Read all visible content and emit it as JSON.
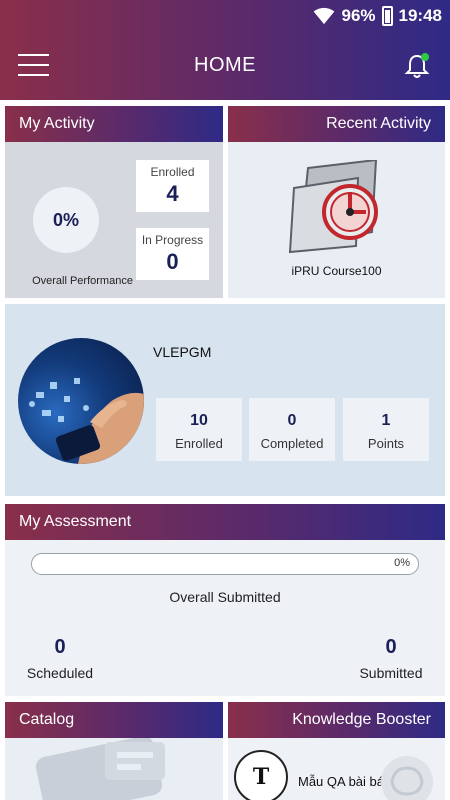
{
  "status_bar": {
    "battery": "96%",
    "time": "19:48"
  },
  "app_bar": {
    "title": "HOME"
  },
  "my_activity": {
    "header": "My Activity",
    "performance": "0%",
    "performance_label": "Overall Performance",
    "enrolled_label": "Enrolled",
    "enrolled_value": "4",
    "in_progress_label": "In Progress",
    "in_progress_value": "0"
  },
  "recent_activity": {
    "header": "Recent Activity",
    "course_name": "iPRU Course100"
  },
  "profile": {
    "name": "VLEPGM",
    "stats": [
      {
        "value": "10",
        "label": "Enrolled"
      },
      {
        "value": "0",
        "label": "Completed"
      },
      {
        "value": "1",
        "label": "Points"
      }
    ]
  },
  "my_assessment": {
    "header": "My Assessment",
    "progress_percent": "0%",
    "progress_fraction": 0,
    "caption": "Overall Submitted",
    "scheduled_value": "0",
    "scheduled_label": "Scheduled",
    "submitted_value": "0",
    "submitted_label": "Submitted"
  },
  "catalog": {
    "header": "Catalog"
  },
  "knowledge_booster": {
    "header": "Knowledge Booster",
    "badge_letter": "T",
    "item_title": "Mẫu QA  bài báo"
  },
  "colors": {
    "header_gradient_start": "#8a2f4a",
    "header_gradient_end": "#2e2a86",
    "accent_text": "#1b2056"
  },
  "icons": [
    "menu-icon",
    "bell-icon",
    "wifi-icon",
    "battery-icon",
    "course-icon",
    "avatar-image",
    "catalog-icon",
    "brain-icon"
  ]
}
